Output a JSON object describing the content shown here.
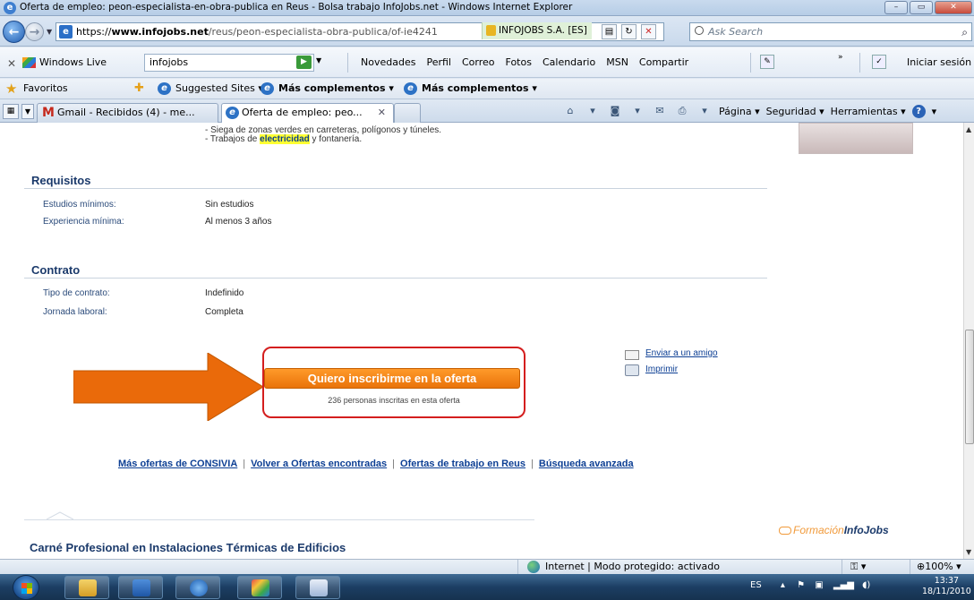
{
  "window": {
    "title": "Oferta de empleo: peon-especialista-en-obra-publica en Reus - Bolsa trabajo InfoJobs.net - Windows Internet Explorer"
  },
  "address": {
    "url_scheme": "https://",
    "url_host": "www.infojobs.net",
    "url_path": "/reus/peon-especialista-obra-publica/of-ie4241",
    "certificate": "INFOJOBS S.A. [ES]",
    "search_placeholder": "Ask Search"
  },
  "live_toolbar": {
    "brand": "Windows Live",
    "query": "infojobs",
    "links": [
      "Novedades",
      "Perfil",
      "Correo",
      "Fotos",
      "Calendario",
      "MSN",
      "Compartir"
    ],
    "signin": "Iniciar sesión"
  },
  "favorites": {
    "label": "Favoritos",
    "items": [
      "Suggested Sites ▾",
      "Más complementos ▾",
      "Más complementos ▾"
    ]
  },
  "tabs": [
    {
      "label": "Gmail - Recibidos (4) - me..."
    },
    {
      "label": "Oferta de empleo: peo..."
    }
  ],
  "commands": {
    "page": "Página ▾",
    "security": "Seguridad ▾",
    "tools": "Herramientas ▾"
  },
  "content": {
    "list_lines": [
      {
        "text": "- Siega de zonas verdes en carreteras, polígonos y túneles."
      },
      {
        "prefix": "- Trabajos de ",
        "highlight": "electricidad",
        "suffix": " y fontanería."
      }
    ],
    "requisitos": {
      "title": "Requisitos",
      "fields": [
        {
          "label": "Estudios mínimos:",
          "value": "Sin estudios"
        },
        {
          "label": "Experiencia mínima:",
          "value": "Al menos 3 años"
        }
      ]
    },
    "contrato": {
      "title": "Contrato",
      "fields": [
        {
          "label": "Tipo de contrato:",
          "value": "Indefinido"
        },
        {
          "label": "Jornada laboral:",
          "value": "Completa"
        }
      ]
    },
    "apply_button": "Quiero inscribirme en la oferta",
    "apply_count": "236 personas inscritas en esta oferta",
    "send_friend": "Enviar a un amigo",
    "print": "Imprimir",
    "bottom_links": [
      "Más ofertas de CONSIVIA",
      "Volver a Ofertas encontradas",
      "Ofertas de trabajo en Reus",
      "Búsqueda avanzada"
    ],
    "formacion_prefix": "Formación",
    "formacion_brand": "InfoJobs",
    "next_title": "Carné Profesional en Instalaciones Térmicas de Edificios"
  },
  "statusbar": {
    "zone": "Internet | Modo protegido: activado",
    "zoom": "100%"
  },
  "taskbar": {
    "language": "ES",
    "time": "13:37",
    "date": "18/11/2010"
  },
  "colors": {
    "accent_orange": "#ff8a1a",
    "arrow_fill": "#ea6a0a",
    "highlight_box": "#d41e1e",
    "link_blue": "#0d3f94"
  }
}
